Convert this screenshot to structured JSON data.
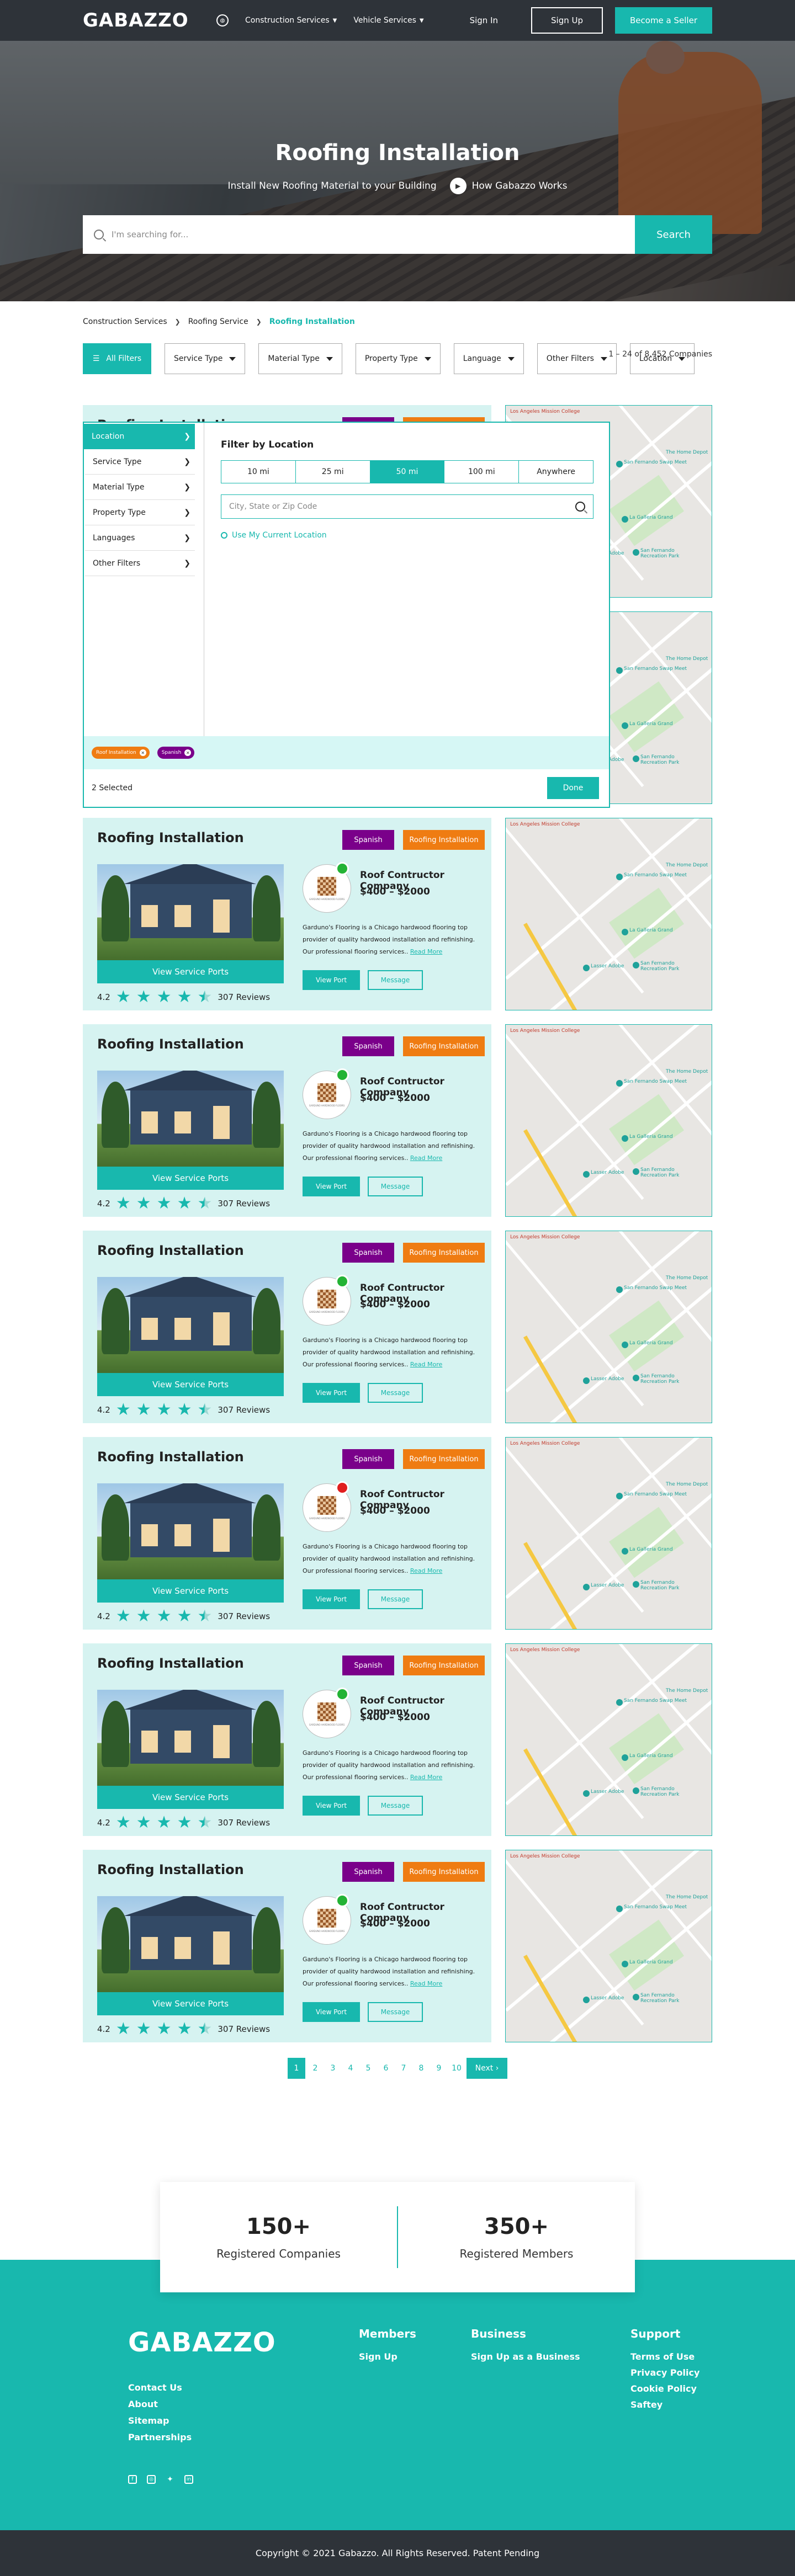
{
  "header": {
    "logo": "GABAZZO",
    "nav": [
      {
        "label": "Construction Services"
      },
      {
        "label": "Vehicle Services"
      }
    ],
    "signin": "Sign In",
    "signup": "Sign Up",
    "seller": "Become a Seller"
  },
  "hero": {
    "title": "Roofing Installation",
    "subtitle": "Install New Roofing Material to your Building",
    "how": "How Gabazzo Works",
    "search_placeholder": "I'm searching for...",
    "search_button": "Search"
  },
  "breadcrumb": [
    "Construction Services",
    "Roofing Service",
    "Roofing Installation"
  ],
  "filters": {
    "all": "All Filters",
    "buttons": [
      "Service Type",
      "Material Type",
      "Property Type",
      "Language",
      "Other Filters",
      "Location"
    ],
    "results": "1 – 24 of 8,452 Companies"
  },
  "panel": {
    "side": [
      "Location",
      "Service Type",
      "Material Type",
      "Property Type",
      "Languages",
      "Other Filters"
    ],
    "title": "Filter by Location",
    "radius": [
      "10 mi",
      "25 mi",
      "50 mi",
      "100 mi",
      "Anywhere"
    ],
    "location_placeholder": "City, State or Zip Code",
    "use_current": "Use My Current Location",
    "tags": [
      {
        "label": "Roof Installation",
        "color": "#ef7c12"
      },
      {
        "label": "Spanish",
        "color": "#7a008a"
      }
    ],
    "selected": "2 Selected",
    "done": "Done"
  },
  "listing": {
    "title": "Roofing Installation",
    "badge_lang": "Spanish",
    "badge_service": "Roofing Installation",
    "company": "Roof Contructor Company",
    "price": "$400 – $2000",
    "desc": "Garduno's Flooring is a Chicago hardwood flooring top provider of quality hardwood installation and refinishing. Our professional flooring services..",
    "read_more": "Read More",
    "view_port": "View Port",
    "message": "Message",
    "view_service": "View Service Ports",
    "rating": "4.2",
    "reviews": "307 Reviews",
    "logo_text": "GARDUNO HARDWOOD FLOORS",
    "map_labels": [
      "The Home Depot",
      "La Galleria Grand",
      "San Fernando Swap Meet",
      "Lasser Adobe",
      "San Fernando Recreation Park",
      "Los Angeles Mission College"
    ]
  },
  "listings": [
    {
      "status": "online"
    },
    {
      "status": "online"
    },
    {
      "status": "online"
    },
    {
      "status": "online"
    },
    {
      "status": "online"
    },
    {
      "status": "busy"
    },
    {
      "status": "online"
    },
    {
      "status": "online"
    }
  ],
  "pager": [
    "1",
    "2",
    "3",
    "4",
    "5",
    "6",
    "7",
    "8",
    "9",
    "10"
  ],
  "pager_next": "Next",
  "stats": [
    {
      "value": "150+",
      "label": "Registered Companies"
    },
    {
      "value": "350+",
      "label": "Registered Members"
    }
  ],
  "footer": {
    "logo": "GABAZZO",
    "links": [
      "Contact Us",
      "About",
      "Sitemap",
      "Partnerships"
    ],
    "members_title": "Members",
    "members": [
      "Sign Up"
    ],
    "business_title": "Business",
    "business": [
      "Sign Up as a Business"
    ],
    "support_title": "Support",
    "support": [
      "Terms of Use",
      "Privacy Policy",
      "Cookie Policy",
      "Saftey"
    ],
    "copyright": "Copyright © 2021 Gabazzo. All Rights Reserved. Patent Pending"
  },
  "colors": {
    "teal": "#18b8ae",
    "dark": "#2e3339",
    "purple": "#7a008a",
    "orange": "#ef7c12"
  }
}
